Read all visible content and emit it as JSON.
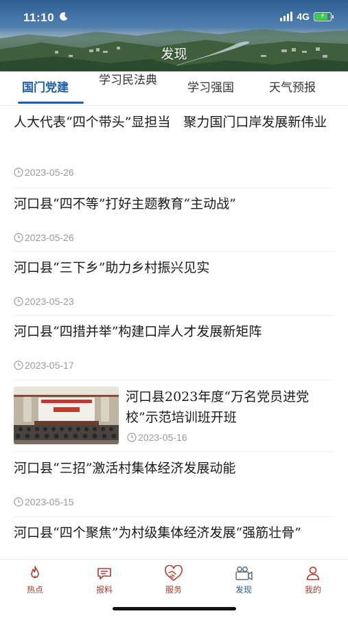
{
  "status_bar": {
    "time": "11:10",
    "network": "4G"
  },
  "header": {
    "title": "发现"
  },
  "tabs": [
    {
      "label": "国门党建",
      "active": true
    },
    {
      "label": "学习民法典",
      "active": false
    },
    {
      "label": "学习强国",
      "active": false
    },
    {
      "label": "天气预报",
      "active": false
    }
  ],
  "articles": [
    {
      "title": "人大代表“四个带头”显担当　聚力国门口岸发展新伟业",
      "date": "2023-05-26"
    },
    {
      "title": "河口县“四不等”打好主题教育“主动战”",
      "date": "2023-05-26"
    },
    {
      "title": "河口县“三下乡”助力乡村振兴见实",
      "date": "2023-05-23"
    },
    {
      "title": "河口县“四措并举”构建口岸人才发展新矩阵",
      "date": "2023-05-17"
    },
    {
      "title": "河口县2023年度“万名党员进党校”示范培训班开班",
      "date": "2023-05-16",
      "has_image": true
    },
    {
      "title": "河口县“三招”激活村集体经济发展动能",
      "date": "2023-05-15"
    },
    {
      "title": "河口县“四个聚焦”为村级集体经济发展“强筋壮骨”",
      "date": ""
    }
  ],
  "bottom_nav": [
    {
      "label": "热点",
      "icon": "flame-icon",
      "active": false
    },
    {
      "label": "报料",
      "icon": "message-icon",
      "active": false
    },
    {
      "label": "服务",
      "icon": "handshake-heart-icon",
      "active": false
    },
    {
      "label": "发现",
      "icon": "video-camera-icon",
      "active": true
    },
    {
      "label": "我的",
      "icon": "user-icon",
      "active": false
    }
  ],
  "colors": {
    "accent": "#1e5fa8",
    "nav_inactive": "#b03a2e",
    "date_gray": "#9a9a9a"
  }
}
